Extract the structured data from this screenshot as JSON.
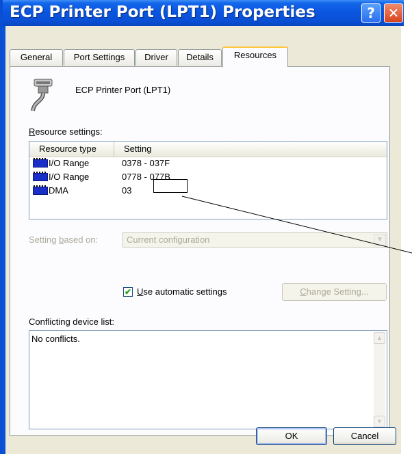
{
  "window": {
    "title": "ECP Printer Port (LPT1) Properties",
    "help_glyph": "?",
    "close_glyph": "✕"
  },
  "tabs": [
    {
      "label": "General"
    },
    {
      "label": "Port Settings"
    },
    {
      "label": "Driver"
    },
    {
      "label": "Details"
    },
    {
      "label": "Resources",
      "active": true
    }
  ],
  "device": {
    "name": "ECP Printer Port (LPT1)",
    "icon": "parallel-port-icon"
  },
  "resource_settings": {
    "label_prefix": "R",
    "label_rest": "esource settings:",
    "columns": [
      "Resource type",
      "Setting"
    ],
    "rows": [
      {
        "type": "I/O Range",
        "setting": "0378 - 037F",
        "icon": "chip-icon"
      },
      {
        "type": "I/O Range",
        "setting_start": "0778 ",
        "setting_sep": "-",
        "setting_end": " 077B",
        "icon": "chip-icon"
      },
      {
        "type": "DMA",
        "setting": "03",
        "icon": "chip-icon"
      }
    ]
  },
  "setting_based_on": {
    "label_pre": "Setting ",
    "label_u": "b",
    "label_post": "ased on:",
    "value": "Current configuration"
  },
  "auto_settings": {
    "checked": true,
    "check_glyph": "✔",
    "label_u": "U",
    "label_rest": "se automatic settings"
  },
  "change_setting": {
    "label_u": "C",
    "label_rest": "hange Setting..."
  },
  "conflicts": {
    "label": "Conflicting device list:",
    "text": "No conflicts."
  },
  "buttons": {
    "ok": "OK",
    "cancel": "Cancel"
  },
  "colors": {
    "title_bar": "#0a53d9",
    "dialog_bg": "#ece9d8",
    "panel_bg": "#fcfcfe",
    "active_tab_accent": "#ffc73c"
  }
}
